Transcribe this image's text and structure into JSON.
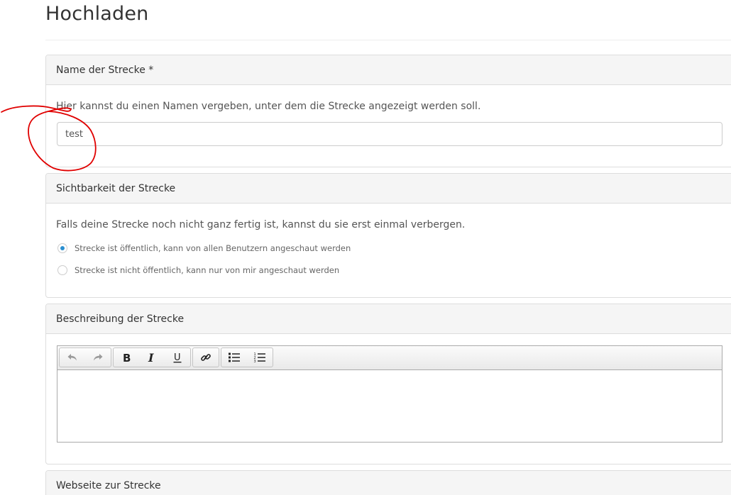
{
  "page": {
    "title": "Hochladen"
  },
  "name_panel": {
    "heading": "Name der Strecke *",
    "help": "Hier kannst du einen Namen vergeben, unter dem die Strecke angezeigt werden soll.",
    "input_value": "test"
  },
  "visibility_panel": {
    "heading": "Sichtbarkeit der Strecke",
    "help": "Falls deine Strecke noch nicht ganz fertig ist, kannst du sie erst einmal verbergen.",
    "options": [
      {
        "label": "Strecke ist öffentlich, kann von allen Benutzern angeschaut werden",
        "selected": true
      },
      {
        "label": "Strecke ist nicht öffentlich, kann nur von mir angeschaut werden",
        "selected": false
      }
    ]
  },
  "description_panel": {
    "heading": "Beschreibung der Strecke",
    "toolbar_icons": [
      "undo-icon",
      "redo-icon",
      "bold-icon",
      "italic-icon",
      "underline-icon",
      "link-icon",
      "bullet-list-icon",
      "numbered-list-icon"
    ],
    "body_text": ""
  },
  "website_panel": {
    "heading": "Webseite zur Strecke"
  },
  "colors": {
    "radio_selected": "#2a8fd0",
    "annotation": "#e00000",
    "panel_heading_bg": "#f5f5f5"
  }
}
